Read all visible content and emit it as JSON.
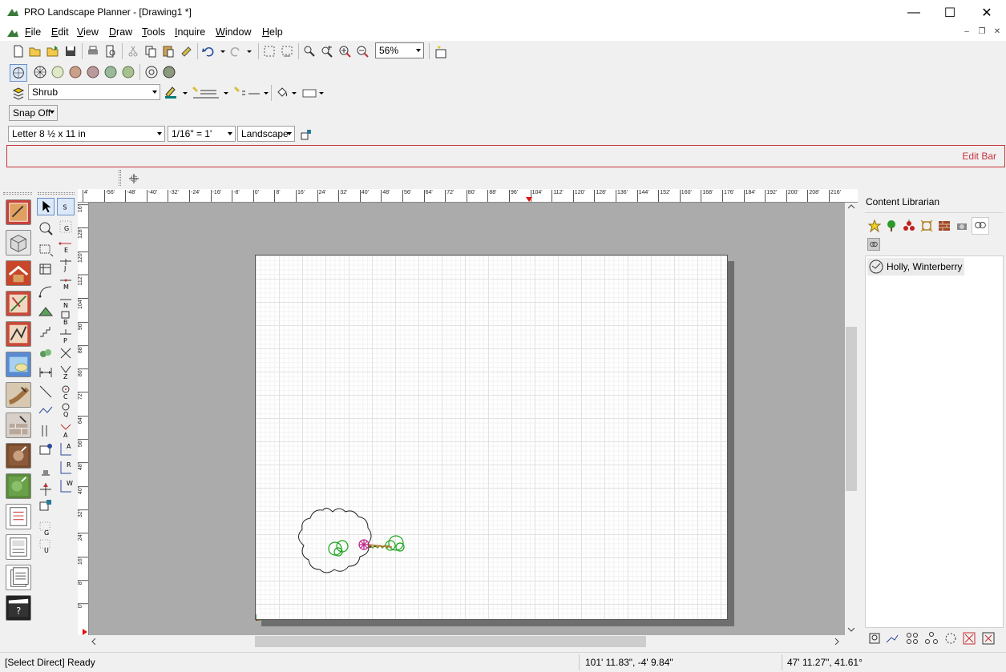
{
  "window": {
    "title": "PRO Landscape Planner - [Drawing1 *]",
    "controls": {
      "minimize": "—",
      "maximize": "☐",
      "close": "✕"
    }
  },
  "menu": {
    "items": [
      {
        "key": "F",
        "rest": "ile"
      },
      {
        "key": "E",
        "rest": "dit"
      },
      {
        "key": "V",
        "rest": "iew"
      },
      {
        "key": "D",
        "rest": "raw"
      },
      {
        "key": "T",
        "rest": "ools"
      },
      {
        "key": "I",
        "rest": "nquire"
      },
      {
        "key": "W",
        "rest": "indow"
      },
      {
        "key": "H",
        "rest": "elp"
      }
    ]
  },
  "toolbar": {
    "zoom_value": "56%",
    "layer_value": "Shrub",
    "snap_label": "Snap Off",
    "paper_size": "Letter 8 ½ x 11 in",
    "scale": "1/16\" = 1'",
    "orientation": "Landscape"
  },
  "edit_bar": {
    "label": "Edit Bar"
  },
  "ruler": {
    "top_ticks": [
      "4'",
      "-56'",
      "-48'",
      "-40'",
      "-32'",
      "-24'",
      "-16'",
      "-8'",
      "0'",
      "8'",
      "16'",
      "24'",
      "32'",
      "40'",
      "48'",
      "56'",
      "64'",
      "72'",
      "80'",
      "88'",
      "96'",
      "104'",
      "112'",
      "120'",
      "128'",
      "136'",
      "144'",
      "152'",
      "160'",
      "168'",
      "176'",
      "184'",
      "192'",
      "200'",
      "208'",
      "216'"
    ],
    "left_ticks": [
      "16'",
      "128'",
      "120'",
      "112'",
      "104'",
      "96'",
      "88'",
      "80'",
      "72'",
      "64'",
      "56'",
      "48'",
      "40'",
      "32'",
      "24'",
      "16'",
      "8'",
      "0'"
    ]
  },
  "small_tool_letters": [
    "S",
    "G",
    "E",
    "J",
    "M",
    "N",
    "B",
    "P",
    "Z",
    "C",
    "Q",
    "A",
    "R",
    "W",
    "G",
    "U"
  ],
  "librarian": {
    "title": "Content Librarian",
    "items": [
      {
        "label": "Holly, Winterberry"
      }
    ]
  },
  "status": {
    "message": "[Select Direct] Ready",
    "coords": "101' 11.83\", -4' 9.84\"",
    "coords2": "47' 11.27\", 41.61°"
  },
  "colors": {
    "edit_bar_border": "#c8323c",
    "canvas_bg": "#ababab",
    "plant_green": "#1aa31a",
    "plant_pink": "#c0208a"
  }
}
